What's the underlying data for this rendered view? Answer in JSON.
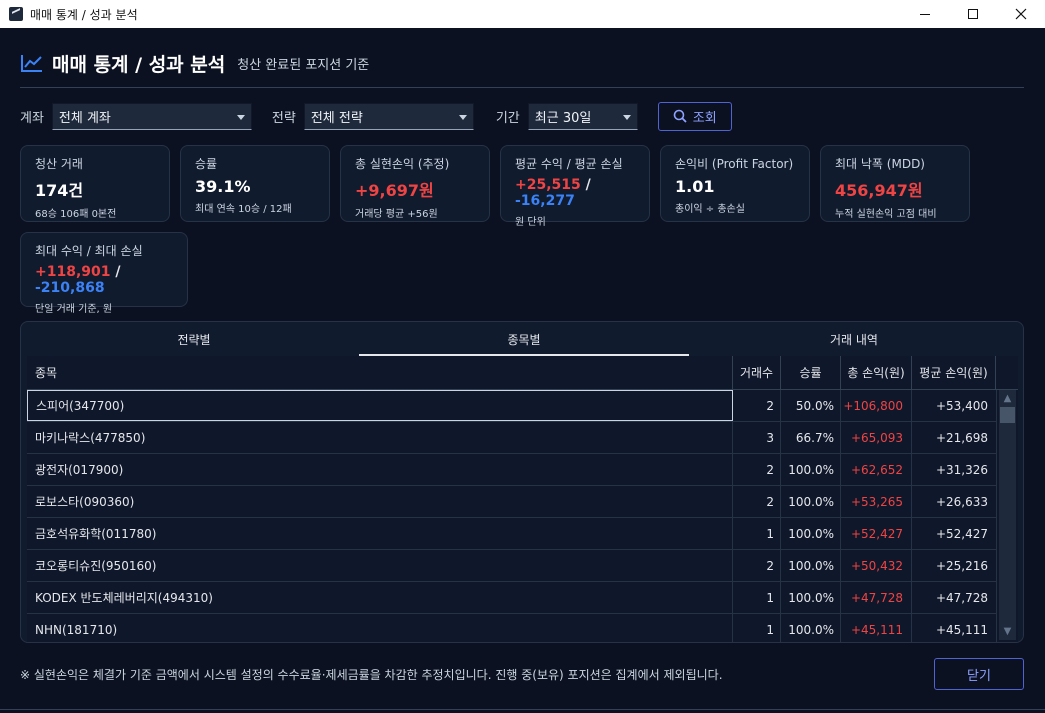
{
  "window": {
    "title": "매매 통계 / 성과 분석"
  },
  "header": {
    "title": "매매 통계 / 성과 분석",
    "subtitle": "청산 완료된 포지션 기준"
  },
  "filters": {
    "account_label": "계좌",
    "account_value": "전체 계좌",
    "strategy_label": "전략",
    "strategy_value": "전체 전략",
    "period_label": "기간",
    "period_value": "최근 30일",
    "search_label": "조회"
  },
  "cards": {
    "closed_trades": {
      "label": "청산 거래",
      "value": "174건",
      "sub": "68승 106패 0본전"
    },
    "win_rate": {
      "label": "승률",
      "value": "39.1%",
      "sub": "최대 연속 10승 / 12패"
    },
    "total_pnl": {
      "label": "총 실현손익 (추정)",
      "value": "+9,697원",
      "sub": "거래당 평균 +56원"
    },
    "avg_pl": {
      "label": "평균 수익 / 평균 손실",
      "profit": "+25,515",
      "sep": "/",
      "loss": "-16,277",
      "sub": "원 단위"
    },
    "profit_factor": {
      "label": "손익비 (Profit Factor)",
      "value": "1.01",
      "sub": "총이익 ÷ 총손실"
    },
    "mdd": {
      "label": "최대 낙폭 (MDD)",
      "value": "456,947원",
      "sub": "누적 실현손익 고점 대비"
    },
    "max_pl": {
      "label": "최대 수익 / 최대 손실",
      "profit": "+118,901",
      "sep": "/",
      "loss": "-210,868",
      "sub": "단일 거래 기준, 원"
    }
  },
  "tabs": [
    {
      "label": "전략별",
      "active": false
    },
    {
      "label": "종목별",
      "active": true
    },
    {
      "label": "거래 내역",
      "active": false
    }
  ],
  "table": {
    "headers": [
      "종목",
      "거래수",
      "승률",
      "총 손익(원)",
      "평균 손익(원)"
    ],
    "rows": [
      {
        "name": "스피어(347700)",
        "count": "2",
        "rate": "50.0%",
        "pnl": "+106,800",
        "avg": "+53,400"
      },
      {
        "name": "마키나락스(477850)",
        "count": "3",
        "rate": "66.7%",
        "pnl": "+65,093",
        "avg": "+21,698"
      },
      {
        "name": "광전자(017900)",
        "count": "2",
        "rate": "100.0%",
        "pnl": "+62,652",
        "avg": "+31,326"
      },
      {
        "name": "로보스타(090360)",
        "count": "2",
        "rate": "100.0%",
        "pnl": "+53,265",
        "avg": "+26,633"
      },
      {
        "name": "금호석유화학(011780)",
        "count": "1",
        "rate": "100.0%",
        "pnl": "+52,427",
        "avg": "+52,427"
      },
      {
        "name": "코오롱티슈진(950160)",
        "count": "2",
        "rate": "100.0%",
        "pnl": "+50,432",
        "avg": "+25,216"
      },
      {
        "name": "KODEX 반도체레버리지(494310)",
        "count": "1",
        "rate": "100.0%",
        "pnl": "+47,728",
        "avg": "+47,728"
      },
      {
        "name": "NHN(181710)",
        "count": "1",
        "rate": "100.0%",
        "pnl": "+45,111",
        "avg": "+45,111"
      }
    ]
  },
  "footer": {
    "note": "※ 실현손익은 체결가 기준 금액에서 시스템 설정의 수수료율·제세금률을 차감한 추정치입니다. 진행 중(보유) 포지션은 집계에서 제외됩니다.",
    "close_label": "닫기"
  },
  "colors": {
    "profit": "#ef4444",
    "loss": "#3b82f6",
    "accent": "#4f63d2"
  }
}
